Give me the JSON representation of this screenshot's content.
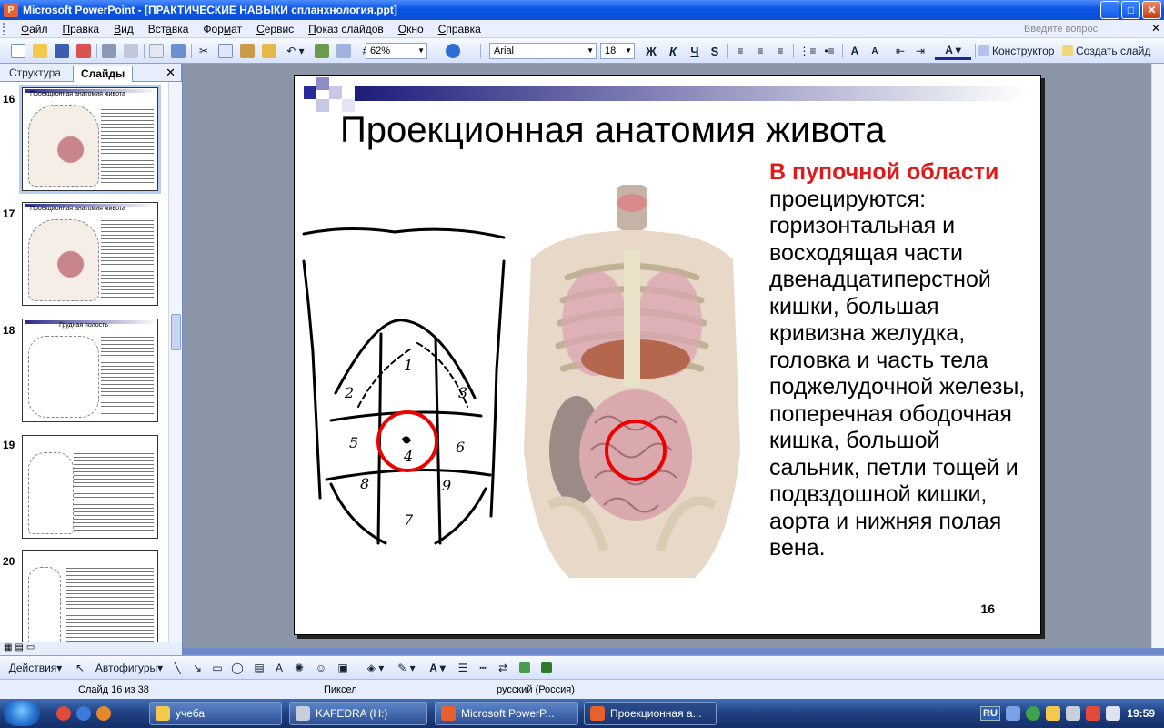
{
  "window": {
    "title": "Microsoft PowerPoint - [ПРАКТИЧЕСКИЕ НАВЫКИ спланхнология.ppt]"
  },
  "menu": {
    "items": [
      {
        "pre": "",
        "key": "Ф",
        "post": "айл"
      },
      {
        "pre": "",
        "key": "П",
        "post": "равка"
      },
      {
        "pre": "",
        "key": "В",
        "post": "ид"
      },
      {
        "pre": "Вст",
        "key": "а",
        "post": "вка"
      },
      {
        "pre": "Фор",
        "key": "м",
        "post": "ат"
      },
      {
        "pre": "",
        "key": "С",
        "post": "ервис"
      },
      {
        "pre": "",
        "key": "П",
        "post": "оказ слайдов"
      },
      {
        "pre": "",
        "key": "О",
        "post": "кно"
      },
      {
        "pre": "",
        "key": "С",
        "post": "правка"
      }
    ],
    "help_placeholder": "Введите вопрос"
  },
  "toolbar": {
    "zoom": "62%",
    "font": "Arial",
    "font_size": "18",
    "bold": "Ж",
    "italic": "К",
    "underline": "Ч",
    "shadow": "S",
    "designer": "Конструктор",
    "new_slide": "Создать слайд"
  },
  "panel": {
    "tab_outline": "Структура",
    "tab_slides": "Слайды",
    "thumbnails": [
      {
        "num": "16",
        "title": "Проекционная анатомия живота",
        "selected": true
      },
      {
        "num": "17",
        "title": "Проекционная анатомия живота",
        "selected": false
      },
      {
        "num": "18",
        "title": "Грудная полость",
        "selected": false
      },
      {
        "num": "19",
        "title": "",
        "selected": false
      },
      {
        "num": "20",
        "title": "",
        "selected": false
      }
    ]
  },
  "slide": {
    "title": "Проекционная анатомия живота",
    "highlight": "В пупочной области",
    "body": "проецируются: горизонтальная и восходящая части двенадцатиперстной кишки, большая кривизна желудка, головка и часть тела поджелудочной железы, поперечная ободочная кишка, большой сальник, петли тощей и подвздошной кишки, аорта и нижняя полая вена.",
    "number": "16",
    "region_labels": [
      "1",
      "2",
      "3",
      "4",
      "5",
      "6",
      "7",
      "8",
      "9"
    ]
  },
  "drawing": {
    "actions": "Действия",
    "autoshapes": "Автофигуры"
  },
  "status": {
    "slide": "Слайд 16 из 38",
    "design": "Пиксел",
    "language": "русский (Россия)"
  },
  "taskbar": {
    "items": [
      "учеба",
      "KAFEDRA (H:)",
      "Microsoft PowerP...",
      "Проекционная а..."
    ],
    "lang": "RU",
    "clock": "19:59"
  }
}
